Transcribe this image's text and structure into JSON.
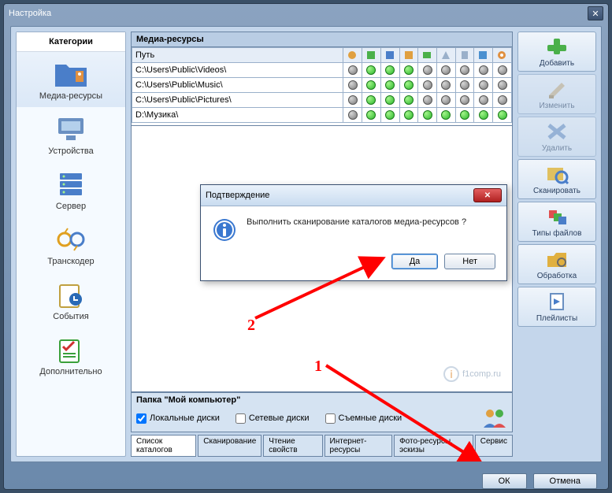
{
  "window": {
    "title": "Настройка"
  },
  "sidebar": {
    "header": "Категории",
    "items": [
      {
        "label": "Медиа-ресурсы"
      },
      {
        "label": "Устройства"
      },
      {
        "label": "Сервер"
      },
      {
        "label": "Транскодер"
      },
      {
        "label": "События"
      },
      {
        "label": "Дополнительно"
      }
    ]
  },
  "main": {
    "group_title": "Медиа-ресурсы",
    "path_header": "Путь",
    "rows": [
      {
        "path": "C:\\Users\\Public\\Videos\\",
        "flags": [
          "gray",
          "green",
          "green",
          "green",
          "gray",
          "gray",
          "gray",
          "gray",
          "gray"
        ]
      },
      {
        "path": "C:\\Users\\Public\\Music\\",
        "flags": [
          "gray",
          "green",
          "green",
          "green",
          "gray",
          "gray",
          "gray",
          "gray",
          "gray"
        ]
      },
      {
        "path": "C:\\Users\\Public\\Pictures\\",
        "flags": [
          "gray",
          "green",
          "green",
          "green",
          "gray",
          "gray",
          "gray",
          "gray",
          "gray"
        ]
      },
      {
        "path": "D:\\Музика\\",
        "flags": [
          "gray",
          "green",
          "green",
          "green",
          "green",
          "green",
          "green",
          "green",
          "green"
        ]
      }
    ]
  },
  "footer": {
    "group_title": "Папка \"Мой компьютер\"",
    "checks": [
      {
        "label": "Локальные диски",
        "checked": true
      },
      {
        "label": "Сетевые диски",
        "checked": false
      },
      {
        "label": "Съемные диски",
        "checked": false
      }
    ],
    "tabs": [
      {
        "label": "Список каталогов",
        "selected": true
      },
      {
        "label": "Сканирование"
      },
      {
        "label": "Чтение свойств"
      },
      {
        "label": "Интернет-ресурсы"
      },
      {
        "label": "Фото-ресурсы, эскизы"
      },
      {
        "label": "Сервис"
      }
    ]
  },
  "right": {
    "buttons": [
      {
        "label": "Добавить"
      },
      {
        "label": "Изменить",
        "disabled": true
      },
      {
        "label": "Удалить",
        "disabled": true
      },
      {
        "label": "Сканировать"
      },
      {
        "label": "Типы файлов"
      },
      {
        "label": "Обработка"
      },
      {
        "label": "Плейлисты"
      }
    ]
  },
  "buttons": {
    "ok": "ОК",
    "cancel": "Отмена"
  },
  "dialog": {
    "title": "Подтверждение",
    "message": "Выполнить сканирование каталогов медиа-ресурсов ?",
    "yes": "Да",
    "no": "Нет"
  },
  "annotations": {
    "label1": "1",
    "label2": "2"
  },
  "watermark": {
    "text": "f1comp.ru"
  }
}
